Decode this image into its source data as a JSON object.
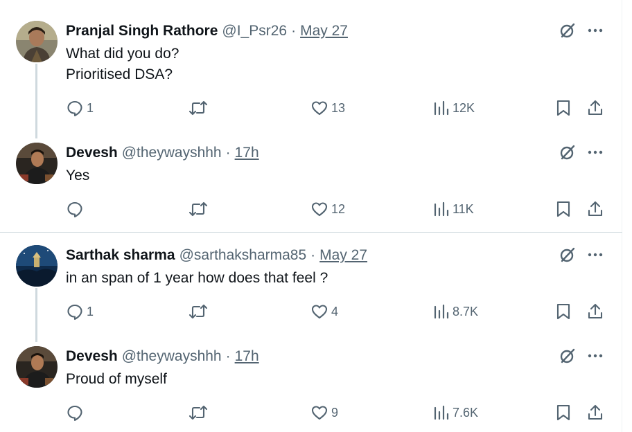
{
  "tweets": [
    {
      "name": "Pranjal Singh Rathore",
      "handle": "@I_Psr26",
      "separator": "·",
      "time": "May 27",
      "lines": [
        "What did you do?",
        "Prioritised DSA?"
      ],
      "replies": "1",
      "retweets": "",
      "likes": "13",
      "views": "12K",
      "avatar_icon": "user-avatar-photo"
    },
    {
      "name": "Devesh",
      "handle": "@theywayshhh",
      "separator": "·",
      "time": "17h",
      "lines": [
        "Yes"
      ],
      "replies": "",
      "retweets": "",
      "likes": "12",
      "views": "11K",
      "avatar_icon": "user-avatar-photo"
    },
    {
      "name": "Sarthak sharma",
      "handle": "@sarthaksharma85",
      "separator": "·",
      "time": "May 27",
      "lines": [
        "in an span of 1 year how does that feel ?"
      ],
      "replies": "1",
      "retweets": "",
      "likes": "4",
      "views": "8.7K",
      "avatar_icon": "user-avatar-photo"
    },
    {
      "name": "Devesh",
      "handle": "@theywayshhh",
      "separator": "·",
      "time": "17h",
      "lines": [
        "Proud of myself"
      ],
      "replies": "",
      "retweets": "",
      "likes": "9",
      "views": "7.6K",
      "avatar_icon": "user-avatar-photo"
    }
  ],
  "icons": {
    "reply": "reply-icon",
    "retweet": "retweet-icon",
    "like": "heart-icon",
    "views": "views-icon",
    "bookmark": "bookmark-icon",
    "share": "share-icon",
    "grok": "grok-icon",
    "more": "more-icon"
  },
  "colors": {
    "text": "#0f1419",
    "secondary": "#536471",
    "border": "#cfd9de"
  }
}
